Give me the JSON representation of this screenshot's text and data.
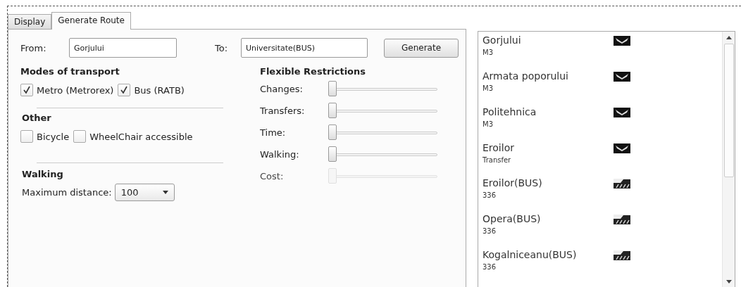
{
  "tabs": [
    {
      "label": "Display",
      "selected": false
    },
    {
      "label": "Generate Route",
      "selected": true
    }
  ],
  "route": {
    "from_label": "From:",
    "from_value": "Gorjului",
    "to_label": "To:",
    "to_value": "Universitate(BUS)",
    "generate_button": "Generate"
  },
  "modes": {
    "title": "Modes of transport",
    "options": [
      {
        "label": "Metro (Metrorex)",
        "checked": true
      },
      {
        "label": "Bus (RATB)",
        "checked": true
      }
    ]
  },
  "other": {
    "title": "Other",
    "options": [
      {
        "label": "Bicycle",
        "checked": false
      },
      {
        "label": "WheelChair accessible",
        "checked": false
      }
    ]
  },
  "walking": {
    "title": "Walking",
    "label": "Maximum distance:",
    "value": "100"
  },
  "restrictions": {
    "title": "Flexible Restrictions",
    "sliders": [
      {
        "label": "Changes:",
        "level": 0,
        "disabled": false
      },
      {
        "label": "Transfers:",
        "level": 0,
        "disabled": false
      },
      {
        "label": "Time:",
        "level": 0,
        "disabled": false
      },
      {
        "label": "Walking:",
        "level": 0,
        "disabled": false
      },
      {
        "label": "Cost:",
        "level": 0,
        "disabled": true
      }
    ]
  },
  "stops": [
    {
      "name": "Gorjului",
      "line": "M3",
      "kind": "metro"
    },
    {
      "name": "Armata poporului",
      "line": "M3",
      "kind": "metro"
    },
    {
      "name": "Politehnica",
      "line": "M3",
      "kind": "metro"
    },
    {
      "name": "Eroilor",
      "line": "Transfer",
      "kind": "metro"
    },
    {
      "name": "Eroilor(BUS)",
      "line": "336",
      "kind": "bus"
    },
    {
      "name": "Opera(BUS)",
      "line": "336",
      "kind": "bus"
    },
    {
      "name": "Kogalniceanu(BUS)",
      "line": "336",
      "kind": "bus"
    }
  ]
}
